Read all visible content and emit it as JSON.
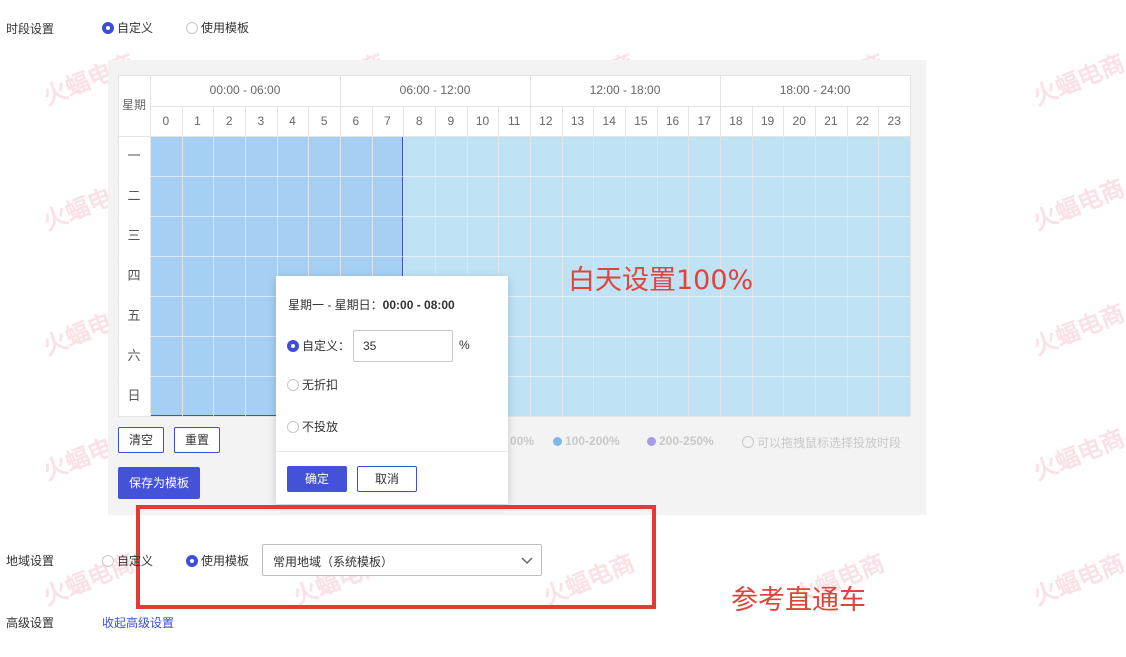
{
  "timeslot": {
    "label": "时段设置",
    "options": [
      "自定义",
      "使用模板"
    ],
    "selected": 0
  },
  "schedule": {
    "corner_label": "星期",
    "ranges": [
      "00:00 - 06:00",
      "06:00 - 12:00",
      "12:00 - 18:00",
      "18:00 - 24:00"
    ],
    "hours": [
      "0",
      "1",
      "2",
      "3",
      "4",
      "5",
      "6",
      "7",
      "8",
      "9",
      "10",
      "11",
      "12",
      "13",
      "14",
      "15",
      "16",
      "17",
      "18",
      "19",
      "20",
      "21",
      "22",
      "23"
    ],
    "days": [
      "一",
      "二",
      "三",
      "四",
      "五",
      "六",
      "日"
    ],
    "colors": {
      "light": "#bfe3f5",
      "selected": "#a5d0f3",
      "border": "#3b4fd9"
    },
    "selection": {
      "hours_from": 0,
      "hours_to": 8,
      "days_from": 0,
      "days_to": 6
    }
  },
  "actions": {
    "clear": "清空",
    "reset": "重置",
    "save_template": "保存为模板"
  },
  "legend": {
    "items": [
      {
        "label": "00%",
        "color": ""
      },
      {
        "label": "100-200%",
        "color": "#7ab8ee"
      },
      {
        "label": "200-250%",
        "color": "#a89ae8"
      }
    ],
    "hint": "可以拖拽鼠标选择投放时段"
  },
  "popup": {
    "title_days": "星期一 - 星期日：",
    "title_time": "00:00 - 08:00",
    "options": [
      "自定义：",
      "无折扣",
      "不投放"
    ],
    "value": "35",
    "unit": "%",
    "confirm": "确定",
    "cancel": "取消"
  },
  "annotation": {
    "day_text": "白天设置100%",
    "ref_text": "参考直通车",
    "color": "#e0433c"
  },
  "region": {
    "label": "地域设置",
    "options": [
      "自定义",
      "使用模板"
    ],
    "selected": 1,
    "select_value": "常用地域（系统模板）"
  },
  "advanced": {
    "label": "高级设置",
    "link": "收起高级设置"
  },
  "watermark": {
    "text": "火蝠电商"
  }
}
